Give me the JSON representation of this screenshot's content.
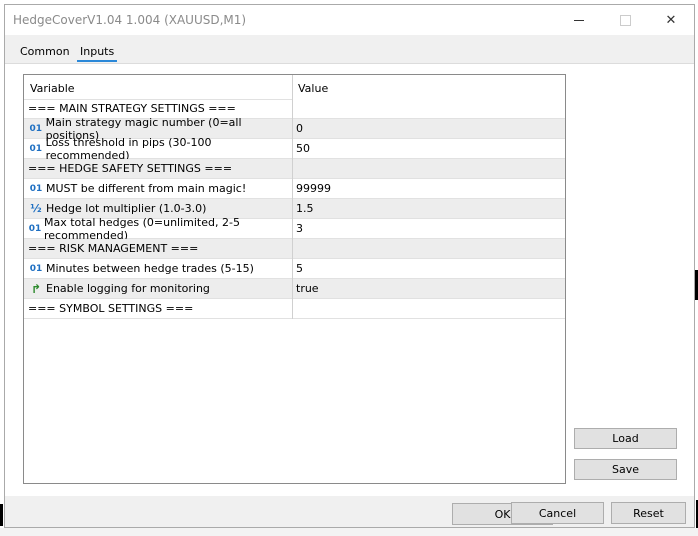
{
  "window": {
    "title": "HedgeCoverV1.04 1.004 (XAUUSD,M1)",
    "close_glyph": "✕"
  },
  "tabs": [
    {
      "label": "Common"
    },
    {
      "label": "Inputs",
      "active": true
    }
  ],
  "grid": {
    "headers": {
      "variable": "Variable",
      "value": "Value"
    },
    "rows": [
      {
        "type": "section",
        "variable": "=== MAIN STRATEGY SETTINGS ===",
        "value": "",
        "icon": ""
      },
      {
        "type": "param",
        "variable": "Magic",
        "display": "Main strategy magic number (0=all positions)",
        "value": "0",
        "icon": "01"
      },
      {
        "type": "param",
        "display": "Loss threshold in pips (30-100 recommended)",
        "value": "50",
        "icon": "01"
      },
      {
        "type": "section",
        "display": "=== HEDGE SAFETY SETTINGS ===",
        "value": "",
        "icon": ""
      },
      {
        "type": "param",
        "display": "MUST be different from main magic!",
        "value": "99999",
        "icon": "01"
      },
      {
        "type": "param",
        "display": "Hedge lot multiplier (1.0-3.0)",
        "value": "1.5",
        "icon": "½"
      },
      {
        "type": "param",
        "display": "Max total hedges (0=unlimited, 2-5 recommended)",
        "value": "3",
        "icon": "01"
      },
      {
        "type": "section",
        "display": "=== RISK MANAGEMENT ===",
        "value": "",
        "icon": ""
      },
      {
        "type": "param",
        "display": "Minutes between hedge trades (5-15)",
        "value": "5",
        "icon": "01"
      },
      {
        "type": "param",
        "display": "Enable logging for monitoring",
        "value": "true",
        "icon": "↱"
      },
      {
        "type": "section",
        "display": "=== SYMBOL SETTINGS ===",
        "value": "",
        "icon": ""
      }
    ]
  },
  "side_buttons": {
    "load": "Load",
    "save": "Save"
  },
  "footer_buttons": {
    "ok": "OK",
    "cancel": "Cancel",
    "reset": "Reset"
  },
  "colors": {
    "tab_accent": "#2b88d8",
    "int_icon": "#1e6fc2",
    "bool_icon": "#2d8a2d"
  }
}
